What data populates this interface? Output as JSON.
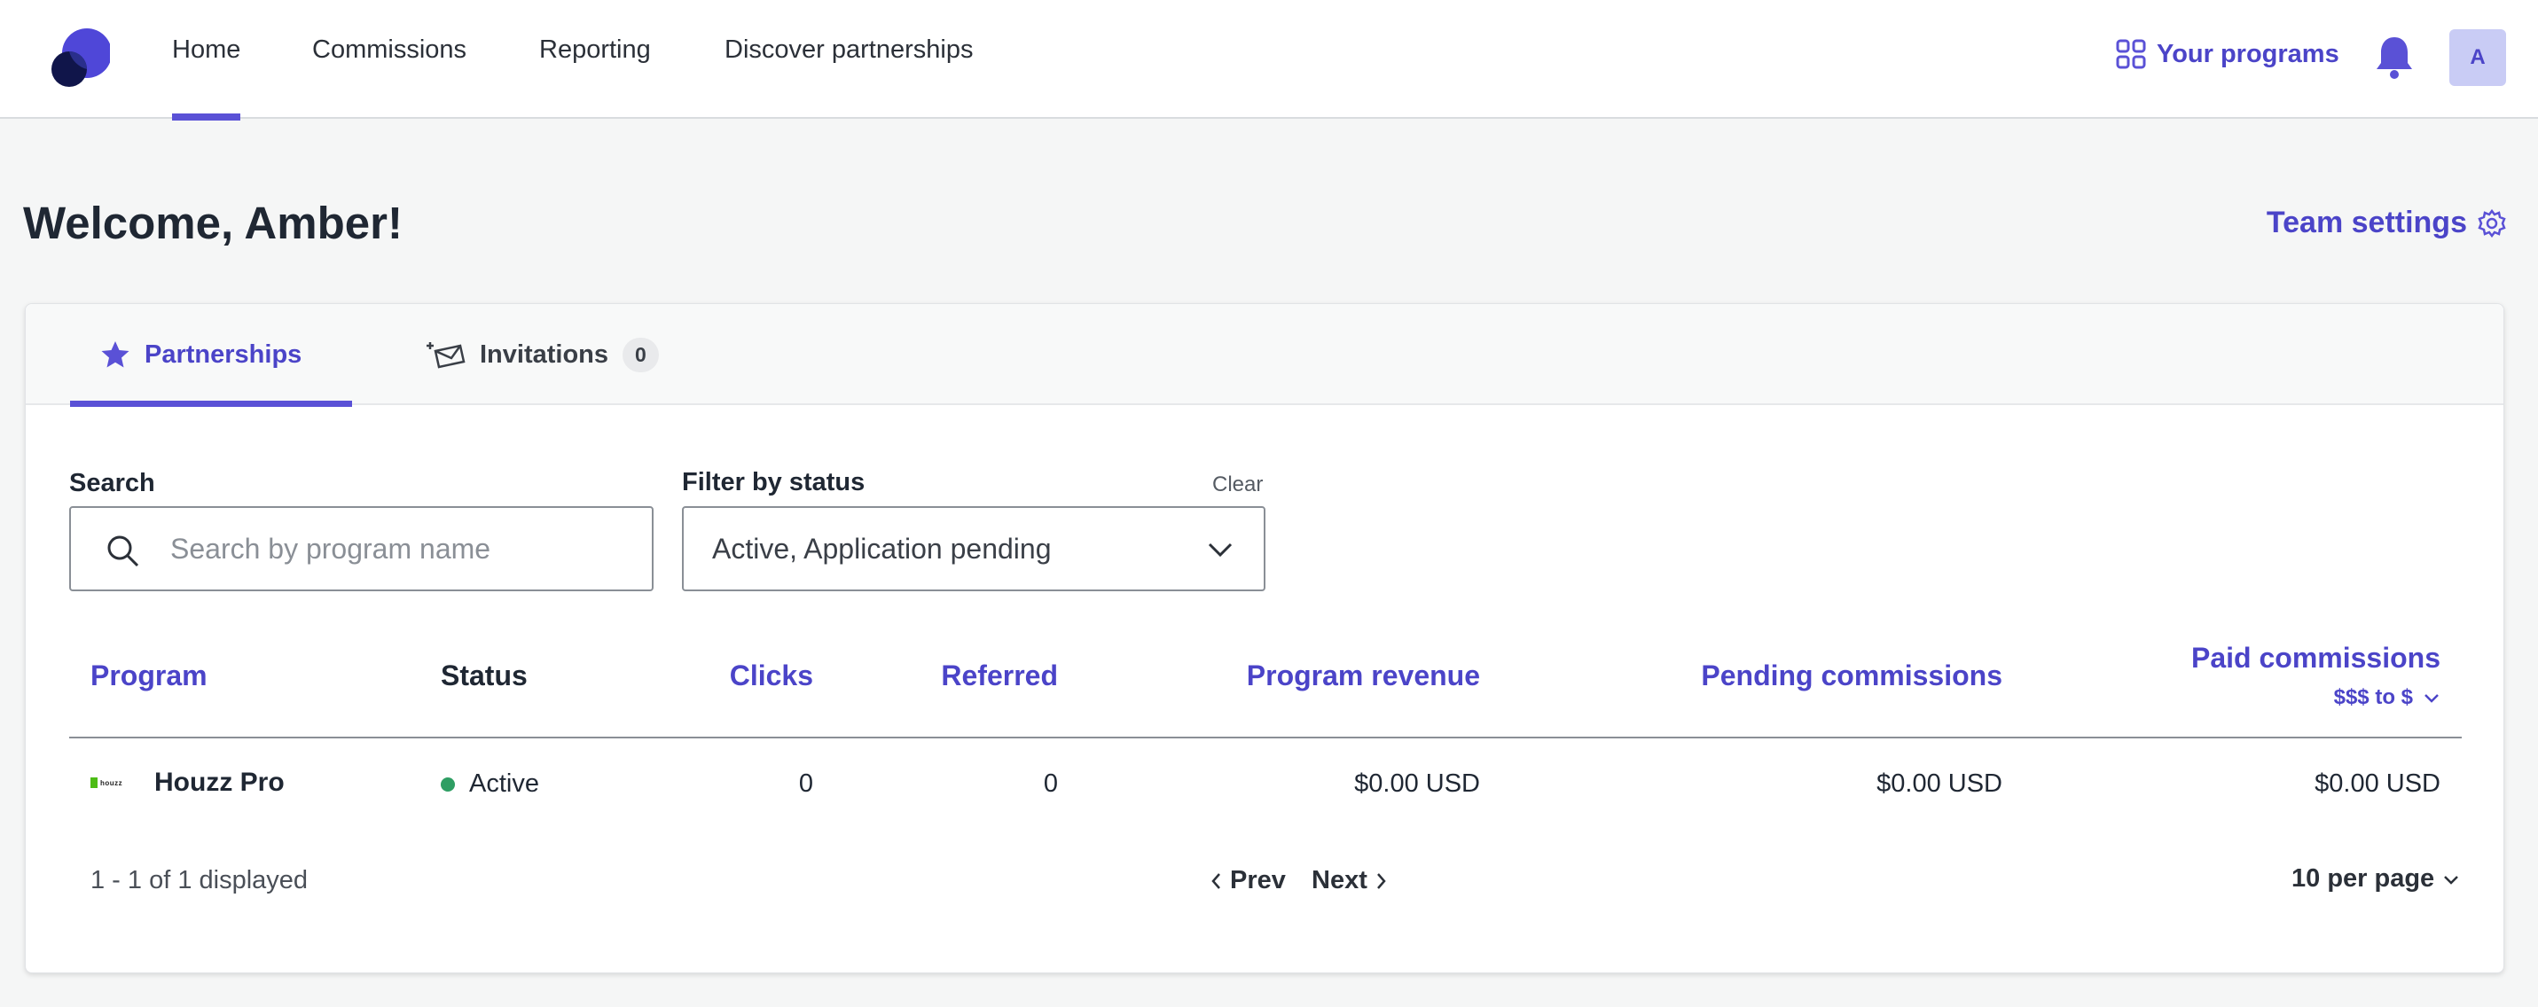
{
  "nav": {
    "tabs": [
      {
        "label": "Home",
        "active": true
      },
      {
        "label": "Commissions",
        "active": false
      },
      {
        "label": "Reporting",
        "active": false
      },
      {
        "label": "Discover partnerships",
        "active": false
      }
    ],
    "your_programs": "Your programs",
    "avatar_initial": "A"
  },
  "header": {
    "welcome": "Welcome, Amber!",
    "team_settings": "Team settings"
  },
  "card_tabs": {
    "partnerships": "Partnerships",
    "invitations": "Invitations",
    "invitations_count": "0"
  },
  "filters": {
    "search_label": "Search",
    "search_placeholder": "Search by program name",
    "search_value": "",
    "status_label": "Filter by status",
    "clear": "Clear",
    "status_value": "Active, Application pending"
  },
  "table": {
    "columns": {
      "program": "Program",
      "status": "Status",
      "clicks": "Clicks",
      "referred": "Referred",
      "program_revenue": "Program revenue",
      "pending_commissions": "Pending commissions",
      "paid_commissions": "Paid commissions",
      "paid_sort": "$$$ to $"
    },
    "rows": [
      {
        "logo_text": "houzz",
        "program": "Houzz Pro",
        "status": "Active",
        "clicks": "0",
        "referred": "0",
        "program_revenue": "$0.00 USD",
        "pending_commissions": "$0.00 USD",
        "paid_commissions": "$0.00 USD"
      }
    ]
  },
  "pagination": {
    "count": "1 - 1 of 1 displayed",
    "prev": "Prev",
    "next": "Next",
    "per_page": "10 per page"
  },
  "colors": {
    "accent": "#4b44c8",
    "accent_bar": "#5a51d6",
    "active_status": "#2e9e63",
    "page_bg": "#f5f6f6"
  }
}
